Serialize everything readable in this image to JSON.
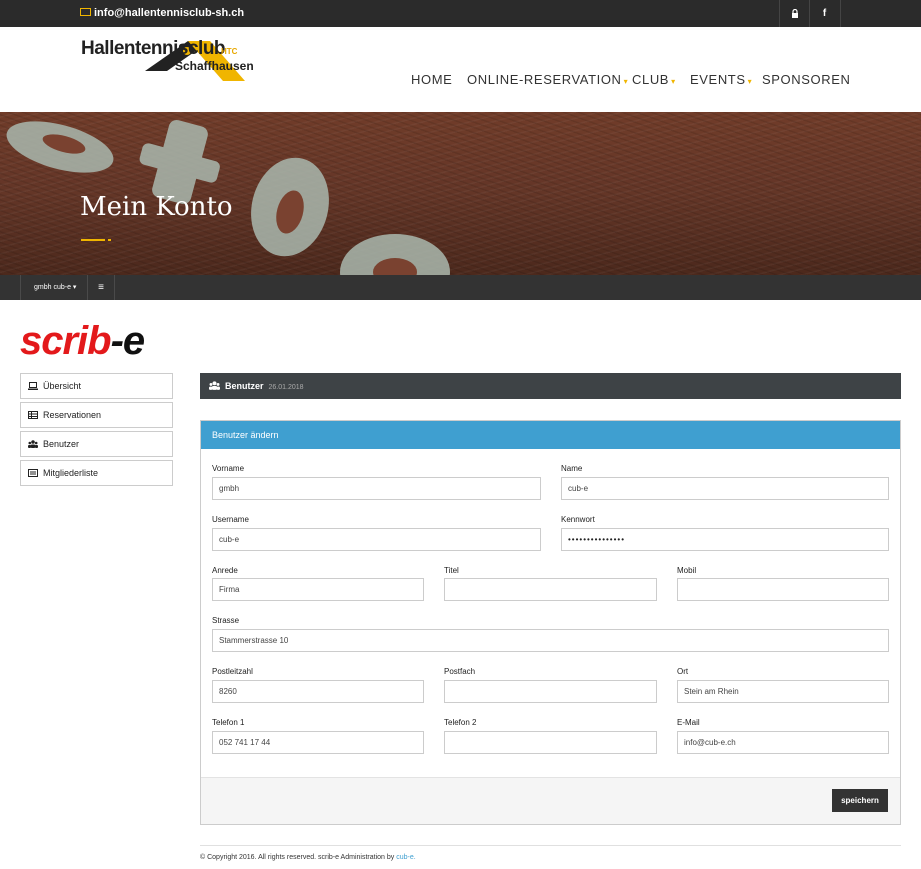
{
  "topbar": {
    "email": "info@hallentennisclub-sh.ch",
    "icons": [
      "lock-icon",
      "facebook-icon"
    ],
    "accent": "#f0b500"
  },
  "header": {
    "logo_name": "Hallentennisclub",
    "logo_sub": "Schaffhausen",
    "logo_abbr": "HTC",
    "nav": [
      {
        "label": "HOME",
        "dropdown": false
      },
      {
        "label": "ONLINE-RESERVATION",
        "dropdown": true
      },
      {
        "label": "CLUB",
        "dropdown": true
      },
      {
        "label": "EVENTS",
        "dropdown": true
      },
      {
        "label": "SPONSOREN",
        "dropdown": false
      }
    ]
  },
  "banner": {
    "title": "Mein Konto"
  },
  "adminbar": {
    "user": "gmbh cub-e",
    "menu_icon": "hamburger-icon"
  },
  "scribe_logo": {
    "part1": "scrib",
    "part2": "-e"
  },
  "sidebar": {
    "items": [
      {
        "label": "Übersicht",
        "icon": "laptop-icon"
      },
      {
        "label": "Reservationen",
        "icon": "table-icon"
      },
      {
        "label": "Benutzer",
        "icon": "users-icon"
      },
      {
        "label": "Mitgliederliste",
        "icon": "list-icon"
      }
    ]
  },
  "panel": {
    "title": "Benutzer",
    "date": "26.01.2018"
  },
  "form": {
    "title": "Benutzer ändern",
    "labels": {
      "vorname": "Vorname",
      "name": "Name",
      "username": "Username",
      "kennwort": "Kennwort",
      "anrede": "Anrede",
      "titel": "Titel",
      "mobil": "Mobil",
      "strasse": "Strasse",
      "plz": "Postleitzahl",
      "postfach": "Postfach",
      "ort": "Ort",
      "telefon1": "Telefon 1",
      "telefon2": "Telefon 2",
      "email": "E-Mail"
    },
    "values": {
      "vorname": "gmbh",
      "name": "cub-e",
      "username": "cub-e",
      "kennwort": "•••••••••••••••",
      "anrede": "Firma",
      "titel": "",
      "mobil": "",
      "strasse": "Stammerstrasse 10",
      "plz": "8260",
      "postfach": "",
      "ort": "Stein am Rhein",
      "telefon1": "052 741 17 44",
      "telefon2": "",
      "email": "info@cub-e.ch"
    },
    "save_label": "speichern"
  },
  "footer": {
    "text": "© Copyright 2016. All rights reserved. scrib-e Administration by ",
    "link": "cub-e."
  },
  "colors": {
    "accent": "#f0b500",
    "panel_blue": "#3f9fd0",
    "dark": "#333333",
    "brand_red": "#e3191b"
  }
}
